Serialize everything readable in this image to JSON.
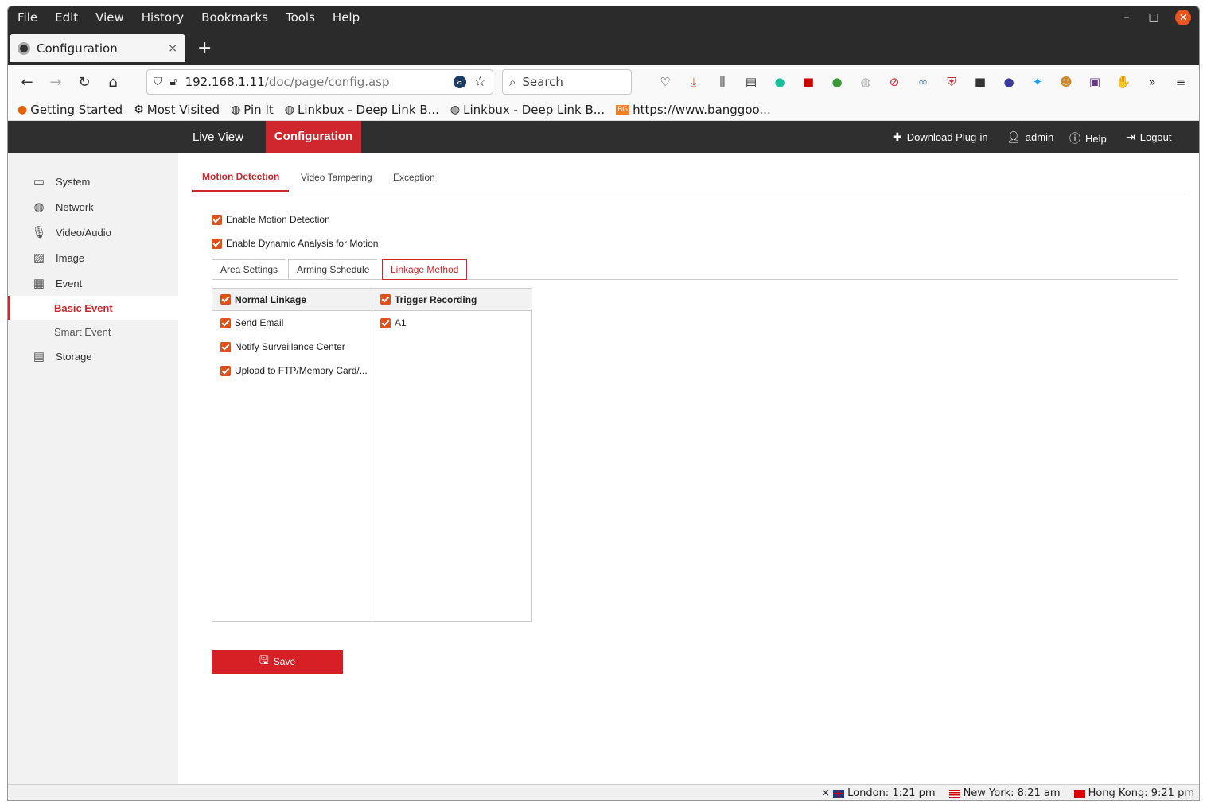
{
  "menubar": [
    "File",
    "Edit",
    "View",
    "History",
    "Bookmarks",
    "Tools",
    "Help"
  ],
  "tab": {
    "title": "Configuration",
    "close": "×",
    "new": "+"
  },
  "url": {
    "host": "192.168.1.11",
    "path": "/doc/page/config.asp"
  },
  "search": {
    "placeholder": "Search"
  },
  "bookmarks": [
    "Getting Started",
    "Most Visited",
    "Pin It",
    "Linkbux - Deep Link B...",
    "Linkbux - Deep Link B...",
    "https://www.banggoo..."
  ],
  "app": {
    "live_view": "Live View",
    "configuration": "Configuration",
    "download_plugin": "Download Plug-in",
    "user": "admin",
    "help": "Help",
    "logout": "Logout"
  },
  "sidebar": {
    "system": "System",
    "network": "Network",
    "video_audio": "Video/Audio",
    "image": "Image",
    "event": "Event",
    "basic_event": "Basic Event",
    "smart_event": "Smart Event",
    "storage": "Storage"
  },
  "subtabs": [
    "Motion Detection",
    "Video Tampering",
    "Exception"
  ],
  "options": {
    "enable_motion": "Enable Motion Detection",
    "enable_dynamic": "Enable Dynamic Analysis for Motion"
  },
  "tabs2": [
    "Area Settings",
    "Arming Schedule",
    "Linkage Method"
  ],
  "linkage": {
    "normal_header": "Normal Linkage",
    "normal_items": [
      "Send Email",
      "Notify Surveillance Center",
      "Upload to FTP/Memory Card/..."
    ],
    "trigger_header": "Trigger Recording",
    "trigger_items": [
      "A1"
    ]
  },
  "save_label": "Save",
  "status": {
    "close": "×",
    "london": "London: 1:21 pm",
    "newyork": "New York: 8:21 am",
    "hongkong": "Hong Kong: 9:21 pm"
  },
  "colors": {
    "accent": "#d0262d",
    "checkbox": "#e0501a",
    "header_dark": "#2f2f2f"
  }
}
